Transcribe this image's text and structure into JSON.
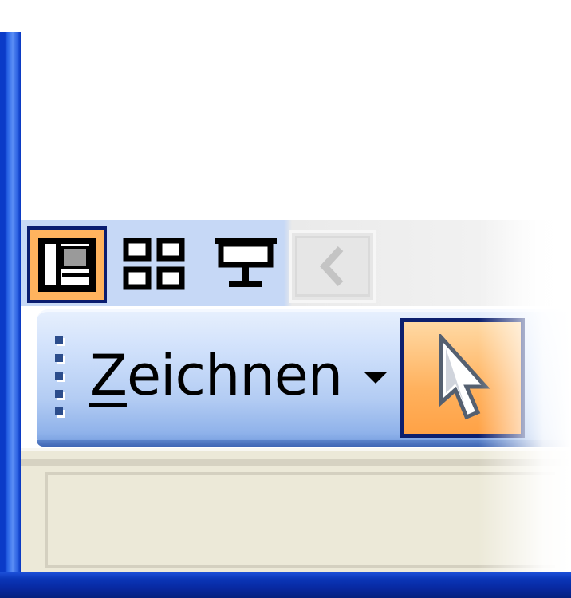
{
  "view_buttons": [
    {
      "name": "normal-view",
      "icon": "normal-view-icon",
      "state": "active"
    },
    {
      "name": "slide-sorter-view",
      "icon": "slide-sorter-icon",
      "state": "normal"
    },
    {
      "name": "slide-show-view",
      "icon": "slide-show-icon",
      "state": "normal"
    }
  ],
  "nav": {
    "prev_icon": "chevron-left-icon",
    "state": "disabled"
  },
  "drawing_toolbar": {
    "menu_label_accel": "Z",
    "menu_label_rest": "eichnen",
    "menu_icon": "dropdown-arrow-icon",
    "select_tool_icon": "pointer-arrow-icon",
    "select_tool_state": "active"
  },
  "colors": {
    "accent_active": "#ffb35e",
    "toolbar_blue": "#c6d8f6",
    "window_border": "#0a3bc8",
    "status_bg": "#ece9d8"
  }
}
